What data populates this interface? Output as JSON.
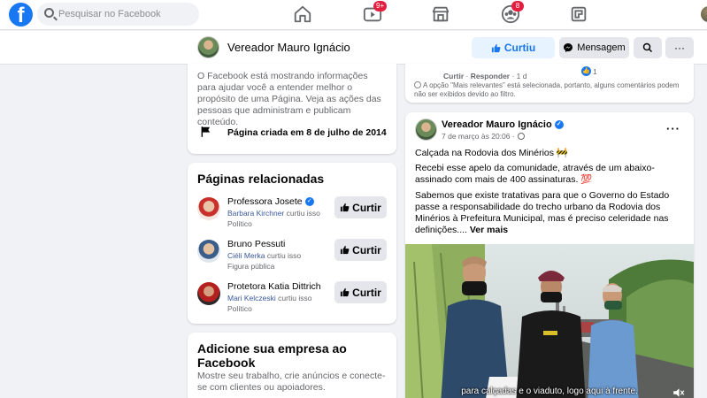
{
  "topbar": {
    "logo": "f",
    "search_placeholder": "Pesquisar no Facebook",
    "nav": [
      {
        "name": "home",
        "badge": ""
      },
      {
        "name": "watch",
        "badge": "9+"
      },
      {
        "name": "marketplace",
        "badge": ""
      },
      {
        "name": "groups",
        "badge": "8"
      },
      {
        "name": "gaming",
        "badge": ""
      }
    ]
  },
  "page_header": {
    "name": "Vereador Mauro Ignácio",
    "liked_label": "Curtiu",
    "message_label": "Mensagem",
    "more_label": "···"
  },
  "transparency": {
    "text": "O Facebook está mostrando informações para ajudar você a entender melhor o propósito de uma Página. Veja as ações das pessoas que administram e publicam conteúdo.",
    "created": "Página criada em 8 de julho de 2014"
  },
  "related": {
    "title": "Páginas relacionadas",
    "button_label": "Curtir",
    "liked_suffix": "curtiu isso",
    "items": [
      {
        "name": "Professora Josete",
        "verified": true,
        "liker": "Barbara Kirchner",
        "category": "Político"
      },
      {
        "name": "Bruno Pessuti",
        "verified": false,
        "liker": "Ciéli Merka",
        "category": "Figura pública"
      },
      {
        "name": "Protetora Katia Dittrich",
        "verified": false,
        "liker": "Mari Kelczeski",
        "category": "Político"
      }
    ]
  },
  "business": {
    "title": "Adicione sua empresa ao Facebook",
    "text": "Mostre seu trabalho, crie anúncios e conecte-se com clientes ou apoiadores."
  },
  "comment": {
    "like_action": "Curtir",
    "reply_action": "Responder",
    "time": "1 d",
    "likes": "1",
    "note": "A opção \"Mais relevantes\" está selecionada, portanto, alguns comentários podem não ser exibidos devido ao filtro."
  },
  "post": {
    "author": "Vereador Mauro Ignácio",
    "date": "7 de março às 20:06 ·",
    "p1": "Calçada na Rodovia dos Minérios 🚧",
    "p2": "Recebi esse apelo da comunidade, através de um abaixo-assinado com mais de 400 assinaturas. 💯",
    "p3": "Sabemos que existe tratativas para que o Governo do Estado passe a responsabilidade do trecho urbano da Rodovia dos Minérios à Prefeitura Municipal, mas é preciso celeridade nas definições.... ",
    "see_more": "Ver mais",
    "video_subtitle": "para calçadas e o viaduto, logo aqui à frente."
  },
  "colors": {
    "brand": "#1877f2",
    "badge": "#e41e3f"
  }
}
